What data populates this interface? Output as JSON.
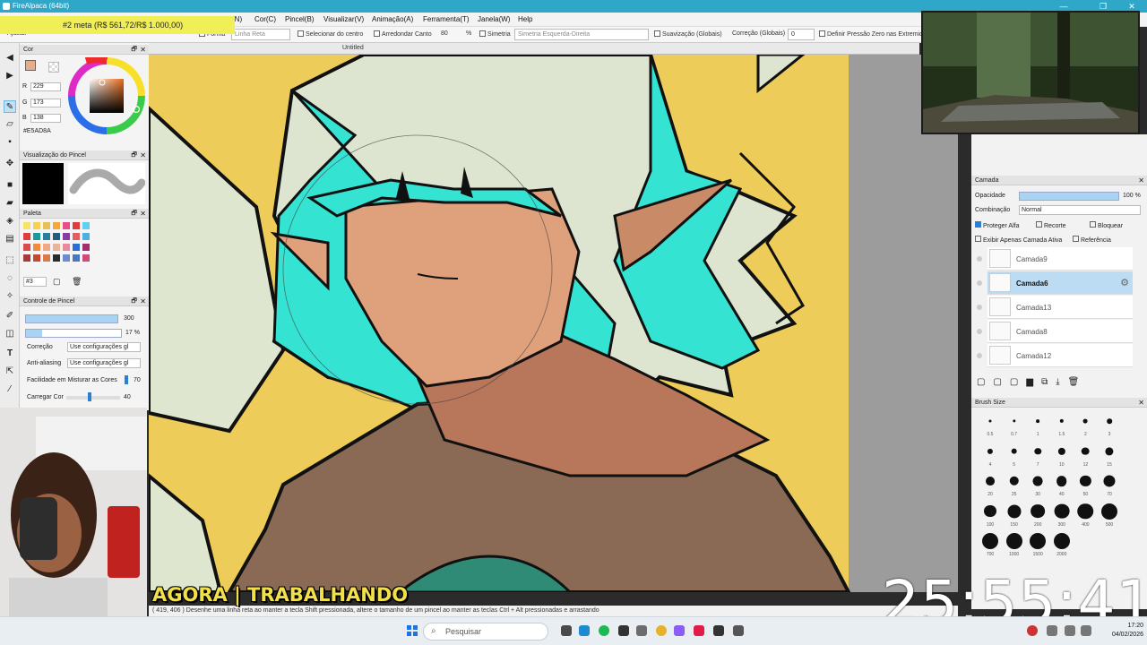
{
  "window": {
    "title": "FireAlpaca (64bit)",
    "controls": [
      "—",
      "❐",
      "✕"
    ]
  },
  "goal": "#2 meta (R$ 561,72/R$ 1.000,00)",
  "menu": [
    "(N)",
    "Cor(C)",
    "Pincel(B)",
    "Visualizar(V)",
    "Animação(A)",
    "Ferramenta(T)",
    "Janela(W)",
    "Help"
  ],
  "menu_left": "Ar",
  "options": {
    "adjust": "Ajustar",
    "shape_label": "Forma",
    "shape_value": "Linha Reta",
    "center_select": "Selecionar do centro",
    "round_corner": "Arredondar Canto",
    "round_value": "80",
    "percent": "%",
    "symmetry": "Simetria",
    "symmetry_value": "Simetria Esquerda-Direita",
    "smoothing": "Suavização (Globais)",
    "correction": "Correção (Globais)",
    "correction_value": "0",
    "pressure_zero": "Definir Pressão Zero nas Extremid"
  },
  "document_tab": "Untitled",
  "color_panel": {
    "title": "Cor",
    "r_label": "R",
    "r": "229",
    "g_label": "G",
    "g": "173",
    "b_label": "B",
    "b": "138",
    "hex": "#E5AD8A",
    "fg_color": "#E5AD8A"
  },
  "brush_preview": {
    "title": "Visualização do Pincel"
  },
  "palette": {
    "title": "Paleta",
    "set_name": "#3",
    "colors": [
      "#f5e36b",
      "#f6d14f",
      "#e8c05a",
      "#f3a83c",
      "#e84d8a",
      "#e03c3c",
      "#5fd0f0",
      "#e03c3c",
      "#1c9a9a",
      "#2a7f9c",
      "#235e7a",
      "#8a3ca0",
      "#e35f5f",
      "#4ab0e0",
      "#d94b4b",
      "#f08a3c",
      "#f2a884",
      "#e8b59b",
      "#e58aa0",
      "#2a6fd0",
      "#a02f6a",
      "#a53a3a",
      "#c24a2f",
      "#d97a4a",
      "#2b2b2b",
      "#6d8cd0",
      "#4a77c0",
      "#d0497a"
    ]
  },
  "brush_control": {
    "title": "Controle de Pincel",
    "size": "300",
    "size_fraction": 1.0,
    "opacity": "17 %",
    "opacity_fraction": 0.17,
    "correction_label": "Correção",
    "correction_value": "Use configurações gl",
    "antialias_label": "Anti-aliasing",
    "antialias_value": "Use configurações gl",
    "blend_label": "Facilidade em Misturar as Cores",
    "blend_value": "70",
    "load_label": "Carregar Cor",
    "load_value": "40"
  },
  "layer_panel": {
    "title": "Camada",
    "opacity_label": "Opacidade",
    "opacity_value": "100 %",
    "opacity_fraction": 1.0,
    "blend_label": "Combinação",
    "blend_value": "Normal",
    "protect_alpha": "Proteger Alfa",
    "clipping": "Recorte",
    "lock": "Bloquear",
    "show_active_only": "Exibir Apenas Camada Ativa",
    "reference": "Referência",
    "layers": [
      {
        "name": "Camada9",
        "selected": false
      },
      {
        "name": "Camada6",
        "selected": true
      },
      {
        "name": "Camada13",
        "selected": false
      },
      {
        "name": "Camada8",
        "selected": false
      },
      {
        "name": "Camada12",
        "selected": false
      }
    ]
  },
  "brush_size_panel": {
    "title": "Brush Size",
    "sizes": [
      "0.5",
      "0.7",
      "1",
      "1.5",
      "2",
      "3",
      "4",
      "5",
      "7",
      "10",
      "12",
      "15",
      "20",
      "25",
      "30",
      "40",
      "50",
      "70",
      "100",
      "150",
      "200",
      "300",
      "400",
      "500",
      "700",
      "1000",
      "1500",
      "2000"
    ]
  },
  "status": {
    "coords": "( 419, 406 )",
    "hint": "Desenhe uma linha reta ao manter a tecla Shift pressionada, altere o tamanho de um pincel ao manter as teclas Ctrl + Alt pressionadas e arrastando"
  },
  "overlay": {
    "caption": "AGORA | TRABALHANDO",
    "timer": "25:55:41"
  },
  "taskbar": {
    "search_placeholder": "Pesquisar",
    "time": "17:20",
    "date": "04/02/2026"
  }
}
